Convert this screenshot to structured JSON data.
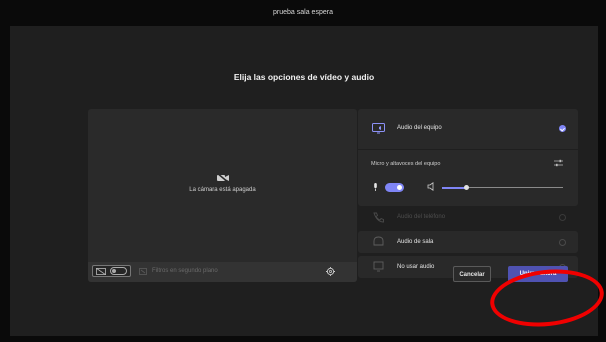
{
  "window": {
    "title": "prueba sala espera"
  },
  "heading": "Elija las opciones de vídeo y audio",
  "video": {
    "camera_off_label": "La cámara está apagada",
    "background_filters_label": "Filtros en segundo plano",
    "camera_toggle_on": false
  },
  "audio_options": {
    "computer_audio": {
      "label": "Audio del equipo",
      "selected": true
    },
    "devices_label": "Micro y altavoces del equipo",
    "mic_on": true,
    "volume_level": 0.2,
    "phone_audio": {
      "label": "Audio del teléfono",
      "selected": false,
      "disabled": true
    },
    "room_audio": {
      "label": "Audio de sala",
      "selected": false
    },
    "no_audio": {
      "label": "No usar audio",
      "selected": false
    }
  },
  "actions": {
    "cancel_label": "Cancelar",
    "join_label": "Unirse ahora"
  },
  "colors": {
    "accent": "#7f85f5",
    "join_button": "#4f52b2",
    "annotation": "#f00000",
    "panel_bg": "#292929"
  },
  "icons": [
    "camera-off-icon",
    "background-effects-icon",
    "filters-icon",
    "settings-icon",
    "computer-audio-icon",
    "sliders-icon",
    "mic-icon",
    "speaker-icon",
    "phone-icon",
    "room-icon",
    "no-audio-icon"
  ]
}
